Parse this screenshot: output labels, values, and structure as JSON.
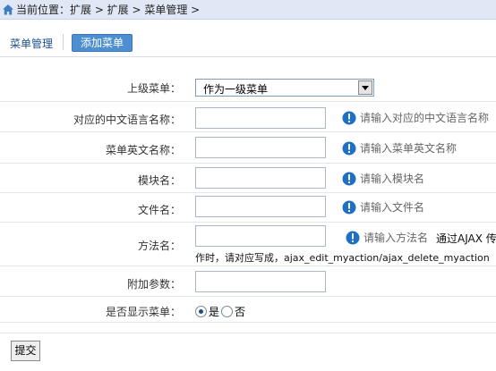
{
  "breadcrumb": {
    "text": "当前位置：扩展 > 扩展 > 菜单管理 >"
  },
  "tabs": {
    "title": "菜单管理",
    "add_button": "添加菜单"
  },
  "form": {
    "parent_menu": {
      "label": "上级菜单：",
      "selected": "作为一级菜单"
    },
    "cn_name": {
      "label": "对应的中文语言名称：",
      "value": "",
      "tip": "请输入对应的中文语言名称"
    },
    "en_name": {
      "label": "菜单英文名称：",
      "value": "",
      "tip": "请输入菜单英文名称"
    },
    "module": {
      "label": "模块名：",
      "value": "",
      "tip": "请输入模块名"
    },
    "file": {
      "label": "文件名：",
      "value": "",
      "tip": "请输入文件名"
    },
    "method": {
      "label": "方法名：",
      "value": "",
      "tip": "请输入方法名",
      "note_line1": "通过AJAX 传",
      "note_line2": "作时，请对应写成，ajax_edit_myaction/ajax_delete_myaction"
    },
    "extra_params": {
      "label": "附加参数：",
      "value": ""
    },
    "display": {
      "label": "是否显示菜单：",
      "yes": "是",
      "no": "否",
      "selected": "yes"
    }
  },
  "submit_label": "提交",
  "colors": {
    "accent": "#4e8fd0",
    "tip_icon": "#1e6fc6",
    "breadcrumb_bg": "#dfe8f4"
  }
}
